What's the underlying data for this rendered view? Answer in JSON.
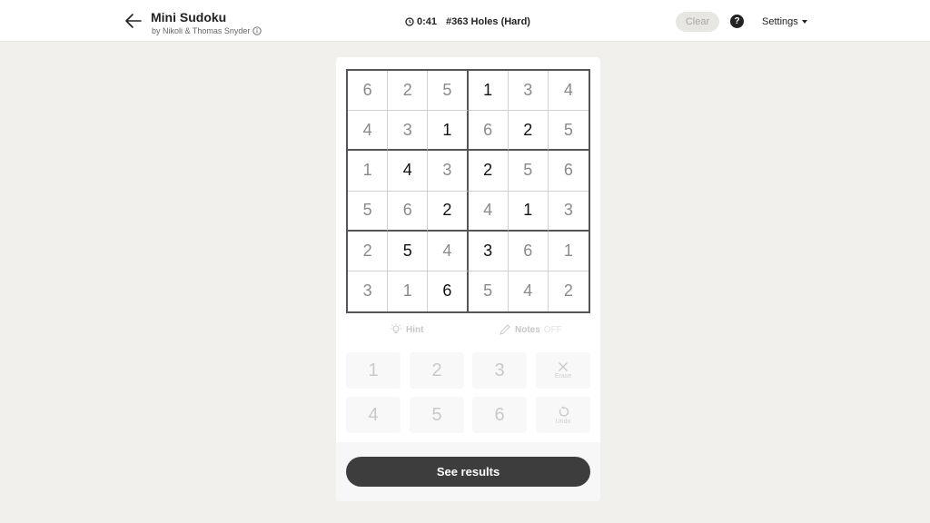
{
  "header": {
    "title": "Mini Sudoku",
    "byline": "by Nikoli & Thomas Snyder",
    "timer": "0:41",
    "puzzle": "#363 Holes (Hard)",
    "clear_label": "Clear",
    "help_label": "?",
    "settings_label": "Settings"
  },
  "board": {
    "cells": [
      [
        "6",
        "2",
        "5",
        "1",
        "3",
        "4"
      ],
      [
        "4",
        "3",
        "1",
        "6",
        "2",
        "5"
      ],
      [
        "1",
        "4",
        "3",
        "2",
        "5",
        "6"
      ],
      [
        "5",
        "6",
        "2",
        "4",
        "1",
        "3"
      ],
      [
        "2",
        "5",
        "4",
        "3",
        "6",
        "1"
      ],
      [
        "3",
        "1",
        "6",
        "5",
        "4",
        "2"
      ]
    ],
    "given": [
      [
        false,
        false,
        false,
        true,
        false,
        false
      ],
      [
        false,
        false,
        true,
        false,
        true,
        false
      ],
      [
        false,
        true,
        false,
        true,
        false,
        false
      ],
      [
        false,
        false,
        true,
        false,
        true,
        false
      ],
      [
        false,
        true,
        false,
        true,
        false,
        false
      ],
      [
        false,
        false,
        true,
        false,
        false,
        false
      ]
    ]
  },
  "toolbar": {
    "hint_label": "Hint",
    "notes_label": "Notes",
    "notes_state": "OFF"
  },
  "keypad": {
    "digits": [
      "1",
      "2",
      "3",
      "4",
      "5",
      "6"
    ],
    "erase_label": "Erase",
    "undo_label": "Undo"
  },
  "footer": {
    "see_results_label": "See results"
  },
  "colors": {
    "given_digit": "#111111",
    "filled_digit": "#8a8a8a",
    "results_button": "#3d3d3d"
  }
}
